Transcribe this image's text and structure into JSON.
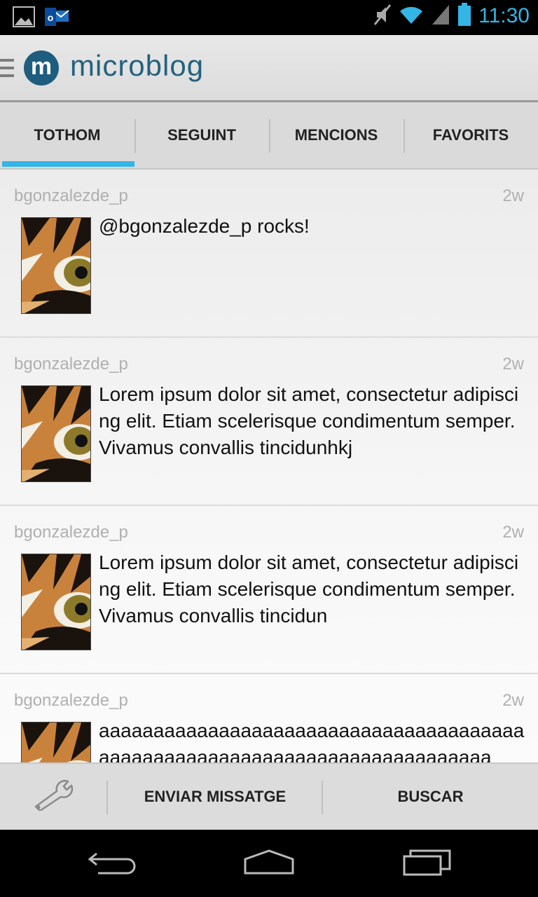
{
  "status_bar": {
    "time": "11:30",
    "left_icons": [
      "gallery-icon",
      "outlook-icon"
    ],
    "right_icons": [
      "mute-icon",
      "wifi-icon",
      "signal-icon",
      "battery-icon"
    ],
    "accent_color": "#33b5e5"
  },
  "action_bar": {
    "logo_letter": "m",
    "title": "microblog"
  },
  "tabs": [
    {
      "label": "TOTHOM",
      "active": true
    },
    {
      "label": "SEGUINT",
      "active": false
    },
    {
      "label": "MENCIONS",
      "active": false
    },
    {
      "label": "FAVORITS",
      "active": false
    }
  ],
  "posts": [
    {
      "author": "bgonzalezde_p",
      "time": "2w",
      "text": "@bgonzalezde_p rocks!"
    },
    {
      "author": "bgonzalezde_p",
      "time": "2w",
      "text": "Lorem ipsum dolor sit amet, consectetur adipiscing elit. Etiam scelerisque condimentum semper. Vivamus convallis tincidunhkj"
    },
    {
      "author": "bgonzalezde_p",
      "time": "2w",
      "text": "Lorem ipsum dolor sit amet, consectetur adipiscing elit. Etiam scelerisque condimentum semper. Vivamus convallis tincidun"
    },
    {
      "author": "bgonzalezde_p",
      "time": "2w",
      "text": "aaaaaaaaaaaaaaaaaaaaaaaaaaaaaaaaaaaaaaaaaaaaaaaaaaaaaaaaaaaaaaaaaaaaaaaaaaa"
    }
  ],
  "bottom_bar": {
    "settings_icon": "wrench-icon",
    "send_label": "ENVIAR MISSATGE",
    "search_label": "BUSCAR"
  },
  "nav_bar": {
    "icons": [
      "back-icon",
      "home-icon",
      "recent-apps-icon"
    ]
  }
}
